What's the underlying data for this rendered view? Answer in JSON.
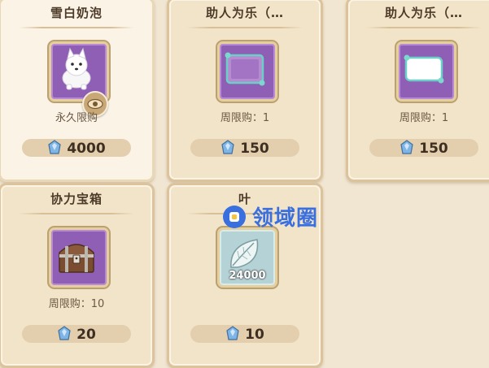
{
  "shop": {
    "items": [
      {
        "name": "雪白奶泡",
        "limit": "永久限购",
        "price": "4000",
        "icon": "white-dog-icon"
      },
      {
        "name": "助人为乐（…",
        "limit": "周限购：1",
        "price": "150",
        "icon": "purple-frame-icon"
      },
      {
        "name": "助人为乐（…",
        "limit": "周限购：1",
        "price": "150",
        "icon": "white-frame-icon"
      },
      {
        "name": "协力宝箱",
        "limit": "周限购：10",
        "price": "20",
        "icon": "treasure-chest-icon"
      },
      {
        "name": "叶",
        "limit": "",
        "price": "10",
        "icon": "leaf-icon",
        "quantity": "24000"
      }
    ]
  },
  "watermark": {
    "text": "领域圈"
  },
  "colors": {
    "background": "#f1e6d2",
    "card": "#f2e4c9",
    "frame_purple": "#8f5fb5",
    "frame_blue": "#b5d2d6",
    "watermark_blue": "#3a6fe0"
  }
}
